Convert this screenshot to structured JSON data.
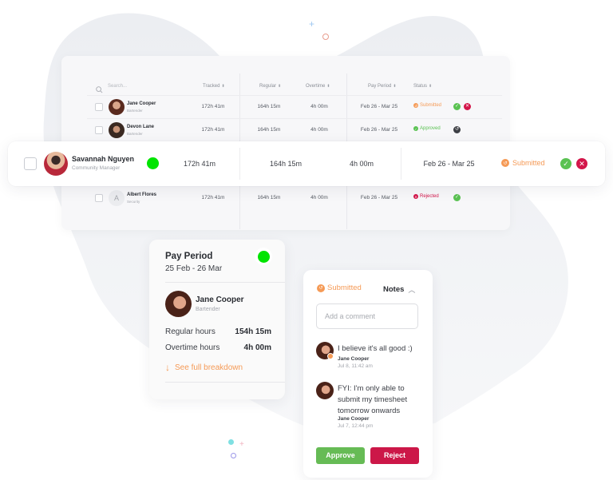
{
  "colors": {
    "blob": "#eef0f4",
    "online": "#00e400",
    "submitted": "#f59a56",
    "approved": "#5ac252",
    "rejected": "#d3164a",
    "approve_btn": "#66bb55",
    "reject_btn": "#cc1748",
    "revert_btn": "#3d3f45",
    "link": "#f59a56",
    "deco_plus_top": "#9ec7f2",
    "deco_ring_top": "#e89d8e",
    "deco_dot_bottom": "#7fe0e2",
    "deco_plus_bottom": "#f2b3c0",
    "deco_ring_bottom": "#9b97e8"
  },
  "table": {
    "search_placeholder": "Search...",
    "columns": {
      "tracked": "Tracked",
      "regular": "Regular",
      "overtime": "Overtime",
      "pay_period": "Pay Period",
      "status": "Status"
    },
    "sort_glyph": "⬍",
    "rows": [
      {
        "name": "Jane Cooper",
        "role": "Bartender",
        "tracked": "172h 41m",
        "regular": "164h 15m",
        "overtime": "4h 00m",
        "pay_period": "Feb 26 - Mar 25",
        "status": "Submitted",
        "status_icon": "↺",
        "actions": [
          "approve",
          "reject"
        ]
      },
      {
        "name": "Devon Lane",
        "role": "Bartender",
        "tracked": "172h 41m",
        "regular": "164h 15m",
        "overtime": "4h 00m",
        "pay_period": "Feb 26 - Mar 25",
        "status": "Approved",
        "status_icon": "✓",
        "actions": [
          "revert"
        ]
      },
      {
        "name": "Albert Flores",
        "role": "Security",
        "initial": "A",
        "tracked": "172h 41m",
        "regular": "164h 15m",
        "overtime": "4h 00m",
        "pay_period": "Feb 26 - Mar 25",
        "status": "Rejected",
        "status_icon": "✕",
        "actions": [
          "approve"
        ]
      }
    ]
  },
  "highlighted_row": {
    "name": "Savannah Nguyen",
    "role": "Community Manager",
    "online": true,
    "tracked": "172h 41m",
    "regular": "164h 15m",
    "overtime": "4h 00m",
    "pay_period": "Feb 26 - Mar 25",
    "status": "Submitted",
    "status_icon": "↺"
  },
  "pay_card": {
    "title": "Pay Period",
    "range": "25 Feb - 26 Mar",
    "online": true,
    "employee": {
      "name": "Jane Cooper",
      "role": "Bartender"
    },
    "regular_label": "Regular hours",
    "regular_value": "154h 15m",
    "overtime_label": "Overtime hours",
    "overtime_value": "4h 00m",
    "link_label": "See full breakdown",
    "link_icon": "↓"
  },
  "notes_card": {
    "status": "Submitted",
    "status_icon": "↺",
    "tab_label": "Notes",
    "tab_icon": "︿",
    "comment_placeholder": "Add a comment",
    "comments": [
      {
        "text": "I believe it's all good :)",
        "author": "Jane Cooper",
        "time": "Jul 8, 11:42 am"
      },
      {
        "text": "FYI: I'm only able to submit my timesheet tomorrow onwards",
        "author": "Jane Cooper",
        "time": "Jul 7, 12:44 pm"
      }
    ],
    "approve_label": "Approve",
    "reject_label": "Reject"
  },
  "icons": {
    "check": "✓",
    "cross": "✕",
    "revert": "↺",
    "plus": "+"
  }
}
